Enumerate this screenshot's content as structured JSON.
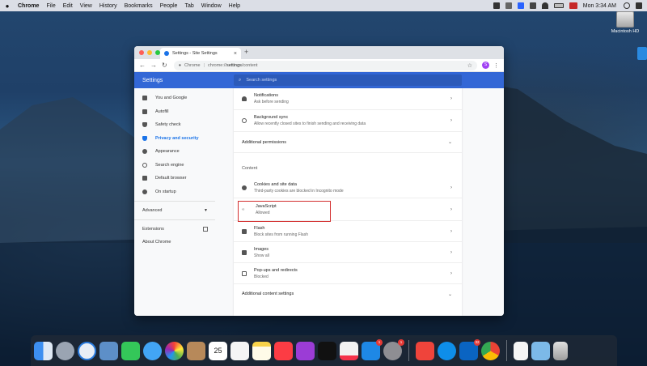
{
  "menubar": {
    "app": "Chrome",
    "items": [
      "File",
      "Edit",
      "View",
      "History",
      "Bookmarks",
      "People",
      "Tab",
      "Window",
      "Help"
    ],
    "clock": "Mon 3:34 AM"
  },
  "desktop": {
    "drive_label": "Macintosh HD"
  },
  "browser": {
    "tab_title": "Settings - Site Settings",
    "url_origin": "Chrome",
    "url_scheme": "chrome://",
    "url_path": "settings",
    "url_rest": "/content",
    "profile_initial": "S"
  },
  "settings": {
    "header_title": "Settings",
    "search_placeholder": "Search settings",
    "sidebar": {
      "items": [
        {
          "label": "You and Google"
        },
        {
          "label": "Autofill"
        },
        {
          "label": "Safety check"
        },
        {
          "label": "Privacy and security"
        },
        {
          "label": "Appearance"
        },
        {
          "label": "Search engine"
        },
        {
          "label": "Default browser"
        },
        {
          "label": "On startup"
        }
      ],
      "advanced": "Advanced",
      "extensions": "Extensions",
      "about": "About Chrome"
    },
    "main": {
      "notifications": {
        "title": "Notifications",
        "subtitle": "Ask before sending"
      },
      "background_sync": {
        "title": "Background sync",
        "subtitle": "Allow recently closed sites to finish sending and receiving data"
      },
      "additional_permissions": "Additional permissions",
      "content_label": "Content",
      "cookies": {
        "title": "Cookies and site data",
        "subtitle": "Third-party cookies are blocked in Incognito mode"
      },
      "javascript": {
        "title": "JavaScript",
        "subtitle": "Allowed"
      },
      "flash": {
        "title": "Flash",
        "subtitle": "Block sites from running Flash"
      },
      "images": {
        "title": "Images",
        "subtitle": "Show all"
      },
      "popups": {
        "title": "Pop-ups and redirects",
        "subtitle": "Blocked"
      },
      "additional_content": "Additional content settings"
    }
  },
  "dock": {
    "calendar_day": "25",
    "badges": {
      "appstore": "1",
      "prefs": "1",
      "outlook": "32"
    }
  }
}
